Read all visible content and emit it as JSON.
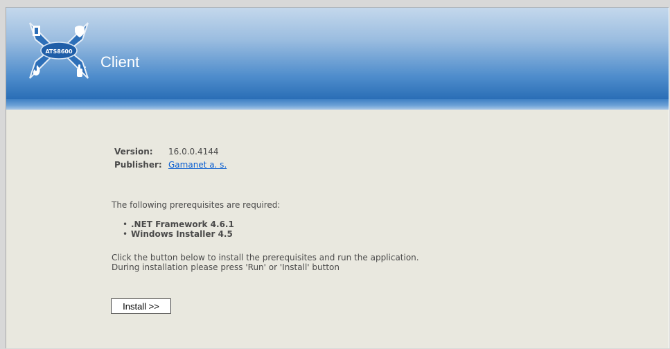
{
  "header": {
    "app_title": "Client",
    "logo_text": "ATS8600"
  },
  "info": {
    "version_label": "Version:",
    "version_value": "16.0.0.4144",
    "publisher_label": "Publisher:",
    "publisher_value": "Gamanet a. s."
  },
  "prerequisites": {
    "intro": "The following prerequisites are required:",
    "items": [
      ".NET Framework 4.6.1",
      "Windows Installer 4.5"
    ]
  },
  "instructions": {
    "line1": "Click the button below to install the prerequisites and run the application.",
    "line2": "During installation please press 'Run' or 'Install' button"
  },
  "install_button": {
    "label": "Install >>"
  },
  "colors": {
    "header_top": "#c4d8ec",
    "header_bottom": "#2a6eb6",
    "page_bg": "#e9e8df",
    "link": "#0b5fd1"
  }
}
